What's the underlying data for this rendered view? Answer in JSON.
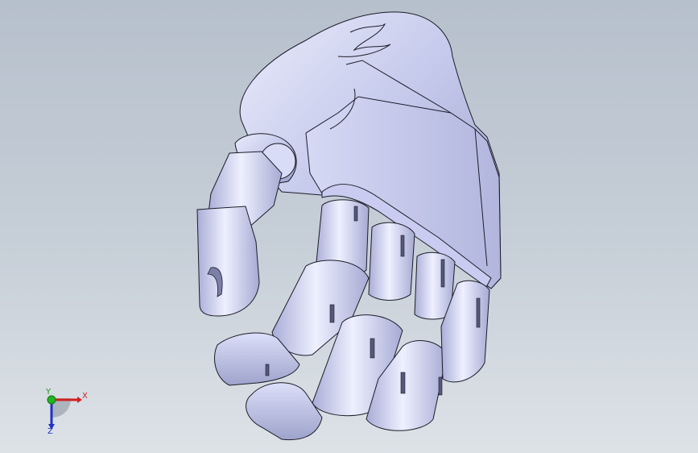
{
  "viewport": {
    "background_top": "#b6c0cc",
    "background_bottom": "#dde2e7"
  },
  "model": {
    "part_color": "#c4c8ec",
    "edge_color": "#1c1c28"
  },
  "triad": {
    "x_label": "X",
    "y_label": "Y",
    "z_label": "Z",
    "x_color": "#d02020",
    "y_color": "#1a9a1a",
    "z_color": "#2030c8"
  }
}
